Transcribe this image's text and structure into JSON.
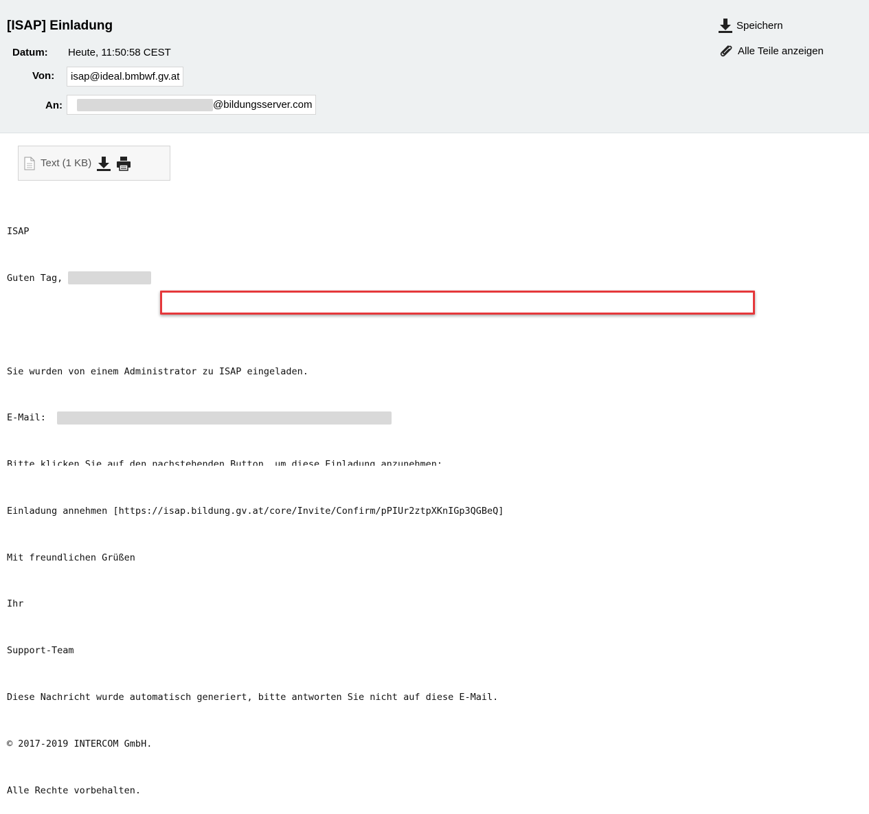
{
  "header": {
    "subject": "[ISAP] Einladung",
    "date_label": "Datum:",
    "date_value": "Heute, 11:50:58 CEST",
    "from_label": "Von:",
    "from_value": "isap@ideal.bmbwf.gv.at",
    "to_label": "An:",
    "to_domain": "@bildungsserver.com"
  },
  "actions": {
    "save_label": "Speichern",
    "show_all_label": "Alle Teile anzeigen"
  },
  "attachment": {
    "label": "Text (1 KB)",
    "download_icon": "download-icon",
    "print_icon": "print-icon"
  },
  "body": {
    "line1": "ISAP",
    "greeting": "Guten Tag,",
    "line3": "Sie wurden von einem Administrator zu ISAP eingeladen.",
    "email_label": "E-Mail:",
    "line5": "Bitte klicken Sie auf den nachstehenden Button, um diese Einladung anzunehmen:",
    "accept_label": "Einladung annehmen",
    "accept_link": "[https://isap.bildung.gv.at/core/Invite/Confirm/pPIUr2ztpXKnIGp3QGBeQ]",
    "regards": "Mit freundlichen Grüßen",
    "ihr": "Ihr",
    "team": "Support-Team",
    "notice": "Diese Nachricht wurde automatisch generiert, bitte antworten Sie nicht auf diese E-Mail.",
    "copyright": "© 2017-2019 INTERCOM GmbH.",
    "rights": "Alle Rechte vorbehalten."
  },
  "colors": {
    "header_bg": "#eef1f2",
    "highlight": "#e5383b"
  }
}
